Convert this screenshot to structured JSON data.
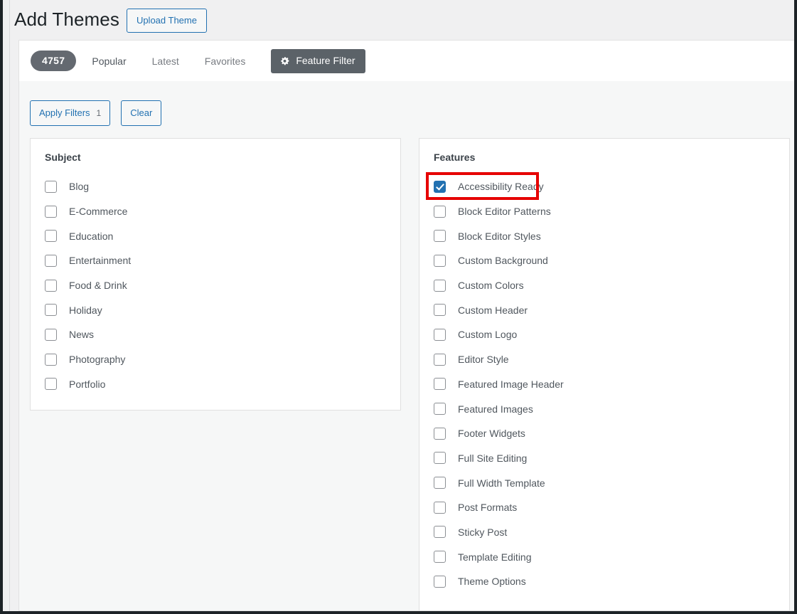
{
  "header": {
    "title": "Add Themes",
    "upload_button": "Upload Theme"
  },
  "navbar": {
    "count": "4757",
    "tabs": [
      {
        "label": "Popular",
        "active": true
      },
      {
        "label": "Latest",
        "active": false
      },
      {
        "label": "Favorites",
        "active": false
      }
    ],
    "feature_filter_label": "Feature Filter",
    "feature_filter_icon": "gear-icon"
  },
  "filters": {
    "apply_label": "Apply Filters",
    "apply_count": "1",
    "clear_label": "Clear",
    "groups": [
      {
        "title": "Subject",
        "items": [
          {
            "label": "Blog",
            "checked": false
          },
          {
            "label": "E-Commerce",
            "checked": false
          },
          {
            "label": "Education",
            "checked": false
          },
          {
            "label": "Entertainment",
            "checked": false
          },
          {
            "label": "Food & Drink",
            "checked": false
          },
          {
            "label": "Holiday",
            "checked": false
          },
          {
            "label": "News",
            "checked": false
          },
          {
            "label": "Photography",
            "checked": false
          },
          {
            "label": "Portfolio",
            "checked": false
          }
        ]
      },
      {
        "title": "Features",
        "items": [
          {
            "label": "Accessibility Ready",
            "checked": true,
            "highlighted": true
          },
          {
            "label": "Block Editor Patterns",
            "checked": false
          },
          {
            "label": "Block Editor Styles",
            "checked": false
          },
          {
            "label": "Custom Background",
            "checked": false
          },
          {
            "label": "Custom Colors",
            "checked": false
          },
          {
            "label": "Custom Header",
            "checked": false
          },
          {
            "label": "Custom Logo",
            "checked": false
          },
          {
            "label": "Editor Style",
            "checked": false
          },
          {
            "label": "Featured Image Header",
            "checked": false
          },
          {
            "label": "Featured Images",
            "checked": false
          },
          {
            "label": "Footer Widgets",
            "checked": false
          },
          {
            "label": "Full Site Editing",
            "checked": false
          },
          {
            "label": "Full Width Template",
            "checked": false
          },
          {
            "label": "Post Formats",
            "checked": false
          },
          {
            "label": "Sticky Post",
            "checked": false
          },
          {
            "label": "Template Editing",
            "checked": false
          },
          {
            "label": "Theme Options",
            "checked": false
          }
        ]
      }
    ]
  },
  "colors": {
    "accent_blue": "#2271b1",
    "dark_gray": "#5b6268",
    "badge_gray": "#646970",
    "annotation_red": "#e60000",
    "page_bg": "#f0f0f1",
    "drawer_bg": "#f6f7f7"
  }
}
